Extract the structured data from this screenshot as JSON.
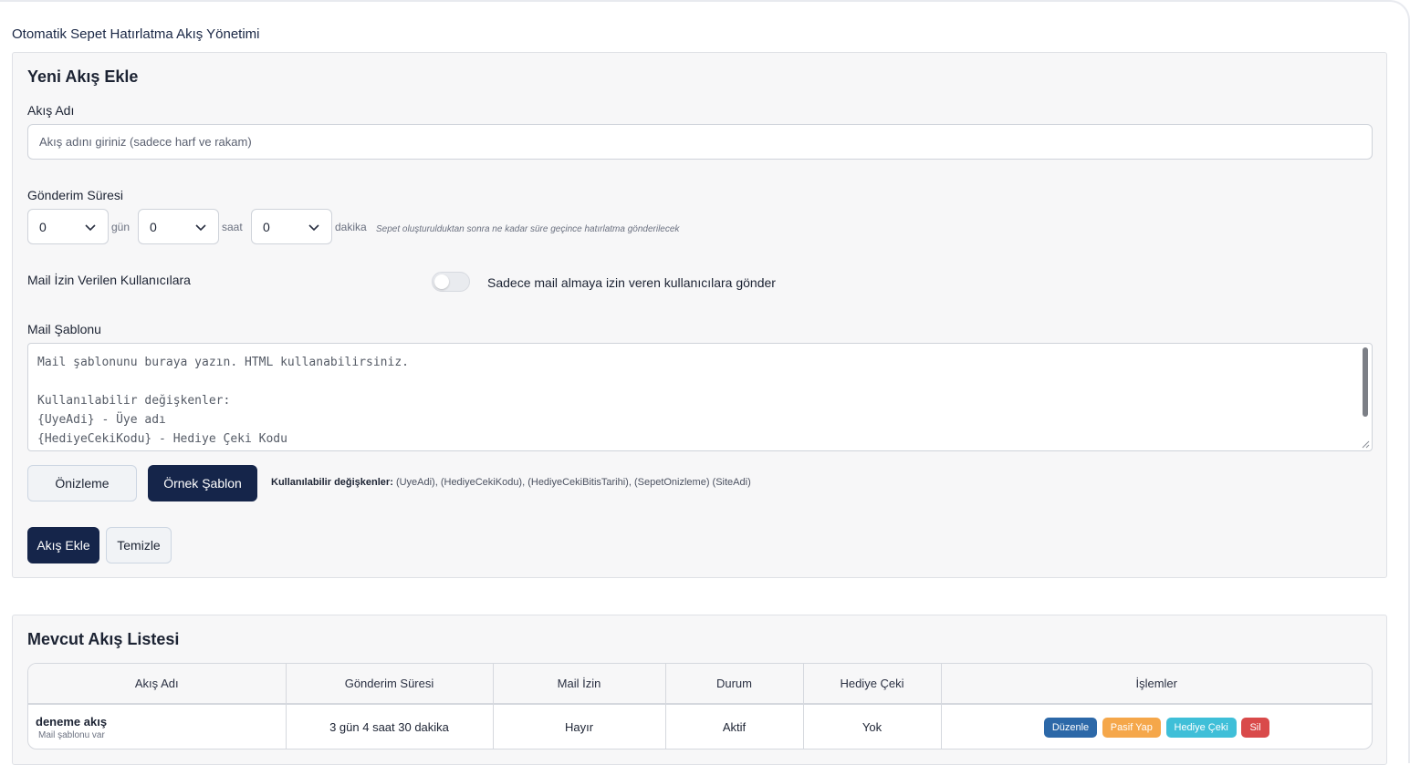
{
  "page": {
    "title": "Otomatik Sepet Hatırlatma Akış Yönetimi"
  },
  "form": {
    "section_title": "Yeni Akış Ekle",
    "name_label": "Akış Adı",
    "name_placeholder": "Akış adını giriniz (sadece harf ve rakam)",
    "name_value": "",
    "delay_label": "Gönderim Süresi",
    "days_value": "0",
    "days_unit": "gün",
    "hours_value": "0",
    "hours_unit": "saat",
    "minutes_value": "0",
    "minutes_unit": "dakika",
    "delay_hint": "Sepet oluşturulduktan sonra ne kadar süre geçince hatırlatma gönderilecek",
    "mail_permission_label": "Mail İzin Verilen Kullanıcılara",
    "mail_permission_toggle_label": "Sadece mail almaya izin veren kullanıcılara gönder",
    "mail_permission_on": false,
    "template_label": "Mail Şablonu",
    "template_text": "Mail şablonunu buraya yazın. HTML kullanabilirsiniz.\n\nKullanılabilir değişkenler:\n{UyeAdi} - Üye adı\n{HediyeCekiKodu} - Hediye Çeki Kodu",
    "preview_button": "Önizleme",
    "sample_button": "Örnek Şablon",
    "vars_label": "Kullanılabilir değişkenler:",
    "vars_list": "(UyeAdi), (HediyeCekiKodu), (HediyeCekiBitisTarihi), (SepetOnizleme) (SiteAdi)",
    "add_button": "Akış Ekle",
    "clear_button": "Temizle"
  },
  "list": {
    "section_title": "Mevcut Akış Listesi",
    "columns": [
      "Akış Adı",
      "Gönderim Süresi",
      "Mail İzin",
      "Durum",
      "Hediye Çeki",
      "İşlemler"
    ],
    "rows": [
      {
        "name": "deneme akış",
        "subtitle": "Mail şablonu var",
        "delay": "3 gün 4 saat 30 dakika",
        "mail_permission": "Hayır",
        "status": "Aktif",
        "gift": "Yok",
        "actions": {
          "edit": "Düzenle",
          "passive": "Pasif Yap",
          "gift": "Hediye Çeki",
          "delete": "Sil"
        }
      }
    ]
  },
  "colors": {
    "primary_dark": "#15254a",
    "edit": "#2c68a8",
    "passive": "#f5a74a",
    "gift": "#3fbfd8",
    "delete": "#d94a4a"
  }
}
